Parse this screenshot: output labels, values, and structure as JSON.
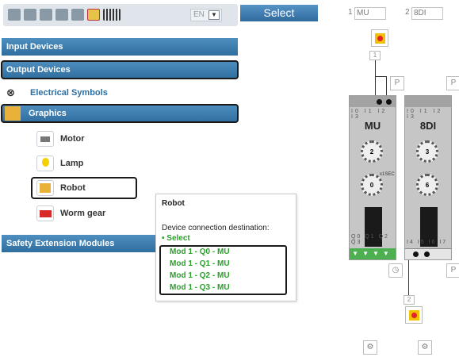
{
  "toolbar": {
    "language": "EN"
  },
  "select_tab": {
    "label": "Select"
  },
  "categories": {
    "input_devices": "Input Devices",
    "output_devices": "Output Devices",
    "electrical_symbols": "Electrical Symbols",
    "graphics": "Graphics",
    "safety_extension_modules": "Safety Extension Modules"
  },
  "graphics_items": [
    {
      "label": "Motor",
      "icon": "motor-icon"
    },
    {
      "label": "Lamp",
      "icon": "lamp-icon"
    },
    {
      "label": "Robot",
      "icon": "robot-icon"
    },
    {
      "label": "Worm gear",
      "icon": "worm-gear-icon"
    }
  ],
  "tooltip": {
    "title": "Robot",
    "description": "Device connection destination:",
    "select_label": "Select",
    "options": [
      "Mod 1 - Q0 - MU",
      "Mod 1 - Q1 - MU",
      "Mod 1 - Q2 - MU",
      "Mod 1 - Q3 - MU"
    ]
  },
  "slots": [
    {
      "number": "1",
      "name": "MU"
    },
    {
      "number": "2",
      "name": "8DI"
    }
  ],
  "modules": [
    {
      "name": "MU",
      "top_terminals": "I0 I1 I2 I3",
      "bottom_terminals": "Q0 Q1 Q2 Q3",
      "knob1": "2",
      "knob2": "0",
      "knob_label": "x1SEC"
    },
    {
      "name": "8DI",
      "top_terminals": "I0 I1 I2 I3",
      "bottom_terminals": "I4 I5 I6 I7",
      "knob1": "3",
      "knob2": "6"
    }
  ],
  "canvas": {
    "p_label": "P",
    "device1_index": "1",
    "device2_index": "2"
  },
  "colors": {
    "accent": "#2f6e9e",
    "green": "#2aa02a",
    "estop_red": "#e0242b",
    "estop_yellow": "#f2c200"
  }
}
